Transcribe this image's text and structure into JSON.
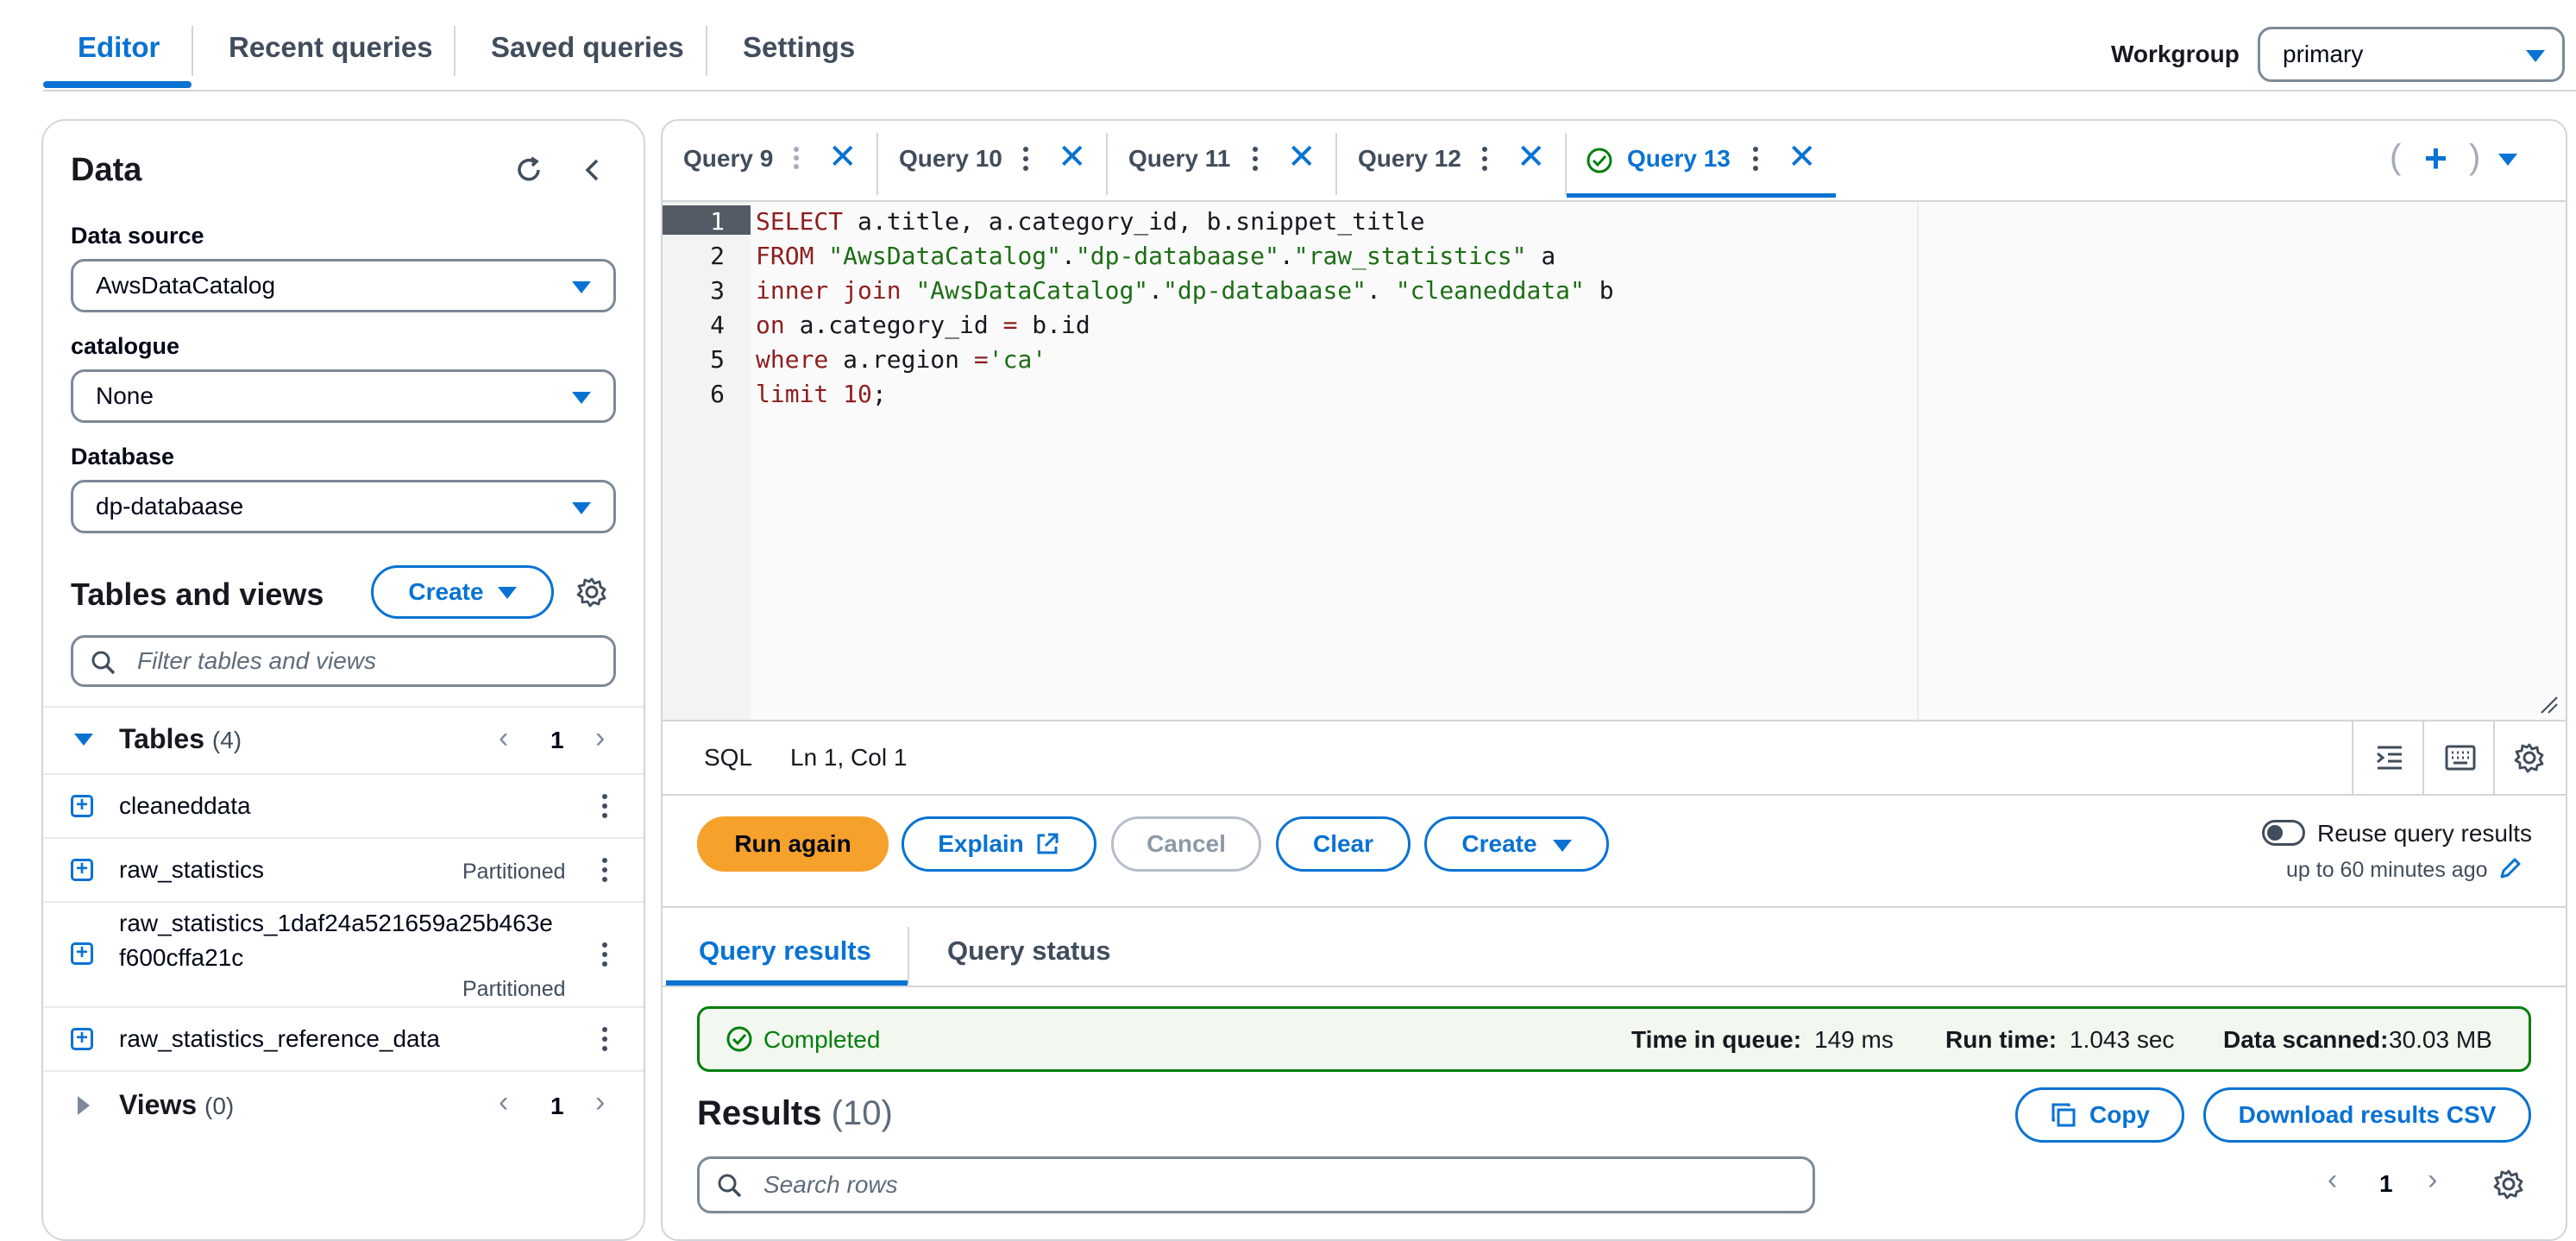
{
  "top_tabs": [
    "Editor",
    "Recent queries",
    "Saved queries",
    "Settings"
  ],
  "workgroup": {
    "label": "Workgroup",
    "value": "primary"
  },
  "data_panel": {
    "title": "Data",
    "data_source": {
      "label": "Data source",
      "value": "AwsDataCatalog"
    },
    "catalogue": {
      "label": "catalogue",
      "value": "None"
    },
    "database": {
      "label": "Database",
      "value": "dp-databaase"
    },
    "tables_views_title": "Tables and views",
    "create_label": "Create",
    "filter_placeholder": "Filter tables and views",
    "tables": {
      "label": "Tables",
      "count": "(4)",
      "page": "1",
      "items": [
        {
          "name": "cleaneddata",
          "badge": ""
        },
        {
          "name": "raw_statistics",
          "badge": "Partitioned"
        },
        {
          "name_line1": "raw_statistics_1daf24a521659a25b463e",
          "name_line2": "f600cffa21c",
          "badge": "Partitioned"
        },
        {
          "name": "raw_statistics_reference_data",
          "badge": ""
        }
      ]
    },
    "views": {
      "label": "Views",
      "count": "(0)",
      "page": "1"
    }
  },
  "query_tabs": [
    "Query 9",
    "Query 10",
    "Query 11",
    "Query 12",
    "Query 13"
  ],
  "editor": {
    "line_numbers": [
      "1",
      "2",
      "3",
      "4",
      "5",
      "6"
    ],
    "language": "SQL",
    "cursor": "Ln 1, Col 1"
  },
  "actions": {
    "run_again": "Run again",
    "explain": "Explain",
    "cancel": "Cancel",
    "clear": "Clear",
    "create": "Create",
    "reuse_label": "Reuse query results",
    "reuse_sub": "up to 60 minutes ago"
  },
  "results_tabs": [
    "Query results",
    "Query status"
  ],
  "status": {
    "state": "Completed",
    "queue_label": "Time in queue:",
    "queue_value": "149 ms",
    "run_label": "Run time:",
    "run_value": "1.043 sec",
    "scanned_label": "Data scanned:",
    "scanned_value": "30.03 MB"
  },
  "results": {
    "title": "Results",
    "count": "(10)",
    "copy": "Copy",
    "download": "Download results CSV",
    "search_placeholder": "Search rows",
    "page": "1"
  },
  "colors": {
    "accent": "#0972d3",
    "primary_button": "#f6a12b",
    "success": "#037f0c"
  }
}
